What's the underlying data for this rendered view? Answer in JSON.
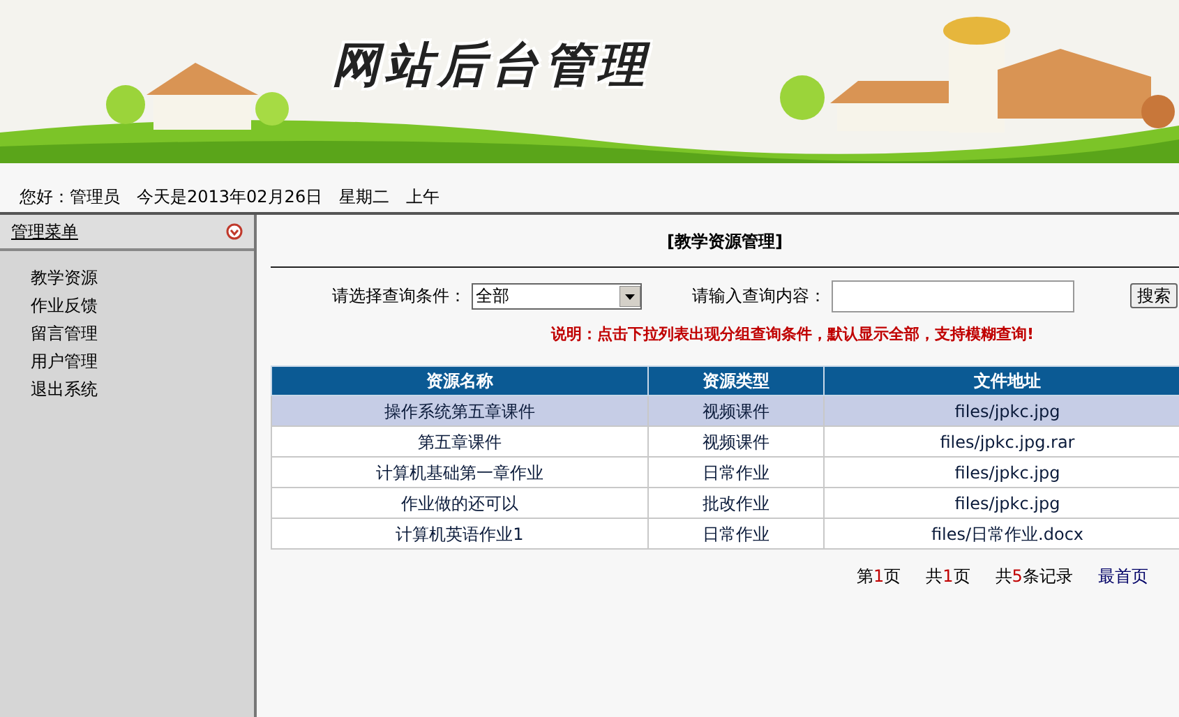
{
  "banner": {
    "title": "网站后台管理"
  },
  "greeting": "您好：管理员　今天是2013年02月26日　星期二　上午",
  "sidebar": {
    "title": "管理菜单",
    "items": [
      {
        "label": "教学资源"
      },
      {
        "label": "作业反馈"
      },
      {
        "label": "留言管理"
      },
      {
        "label": "用户管理"
      },
      {
        "label": "退出系统"
      }
    ]
  },
  "page_title": "[教学资源管理]",
  "search": {
    "condition_label": "请选择查询条件：",
    "condition_value": "全部",
    "content_label": "请输入查询内容：",
    "button": "搜索"
  },
  "note": "说明：点击下拉列表出现分组查询条件，默认显示全部，支持模糊查询!",
  "table": {
    "columns": [
      "资源名称",
      "资源类型",
      "文件地址"
    ],
    "rows": [
      {
        "cells": [
          "操作系统第五章课件",
          "视频课件",
          "files/jpkc.jpg"
        ],
        "selected": true
      },
      {
        "cells": [
          "第五章课件",
          "视频课件",
          "files/jpkc.jpg.rar"
        ],
        "selected": false
      },
      {
        "cells": [
          "计算机基础第一章作业",
          "日常作业",
          "files/jpkc.jpg"
        ],
        "selected": false
      },
      {
        "cells": [
          "作业做的还可以",
          "批改作业",
          "files/jpkc.jpg"
        ],
        "selected": false
      },
      {
        "cells": [
          "计算机英语作业1",
          "日常作业",
          "files/日常作业.docx"
        ],
        "selected": false
      }
    ]
  },
  "pagination": [
    {
      "kind": "count",
      "pre": "第",
      "num": "1",
      "post": "页"
    },
    {
      "kind": "count",
      "pre": "共",
      "num": "1",
      "post": "页"
    },
    {
      "kind": "count",
      "pre": "共",
      "num": "5",
      "post": "条记录"
    },
    {
      "kind": "link",
      "text": "最首页"
    }
  ]
}
